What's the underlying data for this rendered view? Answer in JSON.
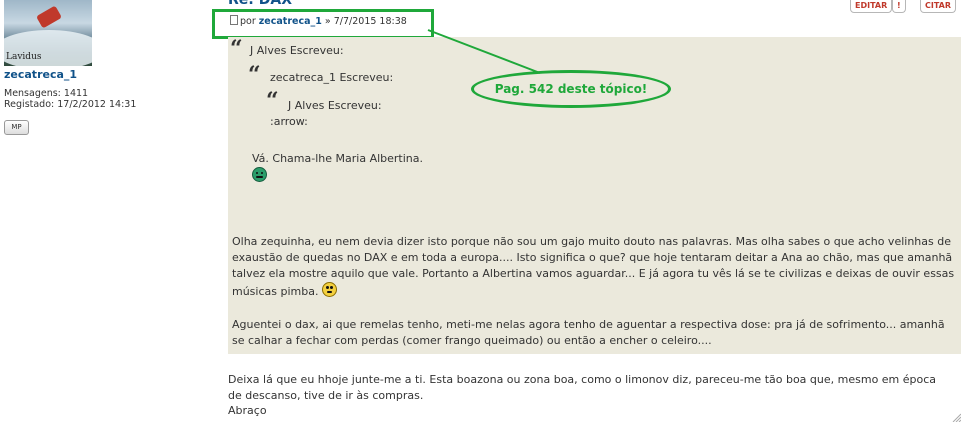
{
  "author_panel": {
    "avatar_caption": "Lavidus",
    "username": "zecatreca_1",
    "posts_label": "Mensagens:",
    "posts_count": "1411",
    "registered_label": "Registado:",
    "registered_date": "17/2/2012 14:31",
    "pm_label": "MP"
  },
  "post": {
    "title": "Re: DAX",
    "by_label": "por",
    "author": "zecatreca_1",
    "separator": "»",
    "datetime": "7/7/2015 18:38",
    "buttons": {
      "edit": "EDITAR",
      "report": "!",
      "quote": "CITAR"
    }
  },
  "quotes": {
    "level1_author": "J Alves Escreveu:",
    "level2_author": "zecatreca_1 Escreveu:",
    "level3_author": "J Alves Escreveu:",
    "level3_text": ":arrow:",
    "level2_text": "Vá. Chama-lhe Maria Albertina.",
    "para1": "Olha zequinha, eu nem devia dizer isto porque não sou um gajo muito douto nas palavras. Mas olha sabes o que acho velinhas de exaustão de quedas no DAX e em toda a europa.... Isto significa o que? que hoje tentaram deitar a Ana ao chão, mas que amanhã talvez ela mostre aquilo que vale. Portanto a Albertina vamos aguardar... E já agora tu vês lá se te civilizas e deixas de ouvir essas músicas pimba.",
    "para2": "Aguentei o dax, ai que remelas tenho, meti-me nelas agora tenho de aguentar a respectiva dose: pra já de sofrimento... amanhã se calhar a fechar com perdas (comer frango queimado) ou então a encher o celeiro...."
  },
  "reply": {
    "text": "Deixa lá que eu hhoje junte-me a ti. Esta boazona ou zona boa, como o limonov diz, pareceu-me tão boa que, mesmo em época de descanso, tive de ir às compras.",
    "signoff": "Abraço"
  },
  "annotation": {
    "callout": "Pag. 542 deste tópico!"
  },
  "colors": {
    "highlight": "#1fa83a",
    "quote_bg": "#ebe9dc",
    "link": "#105289"
  },
  "icons": [
    "avatar-image",
    "document-icon",
    "pm-icon",
    "quote-mark-icon",
    "green-smiley-icon",
    "yellow-smiley-icon",
    "resize-grip-icon"
  ]
}
